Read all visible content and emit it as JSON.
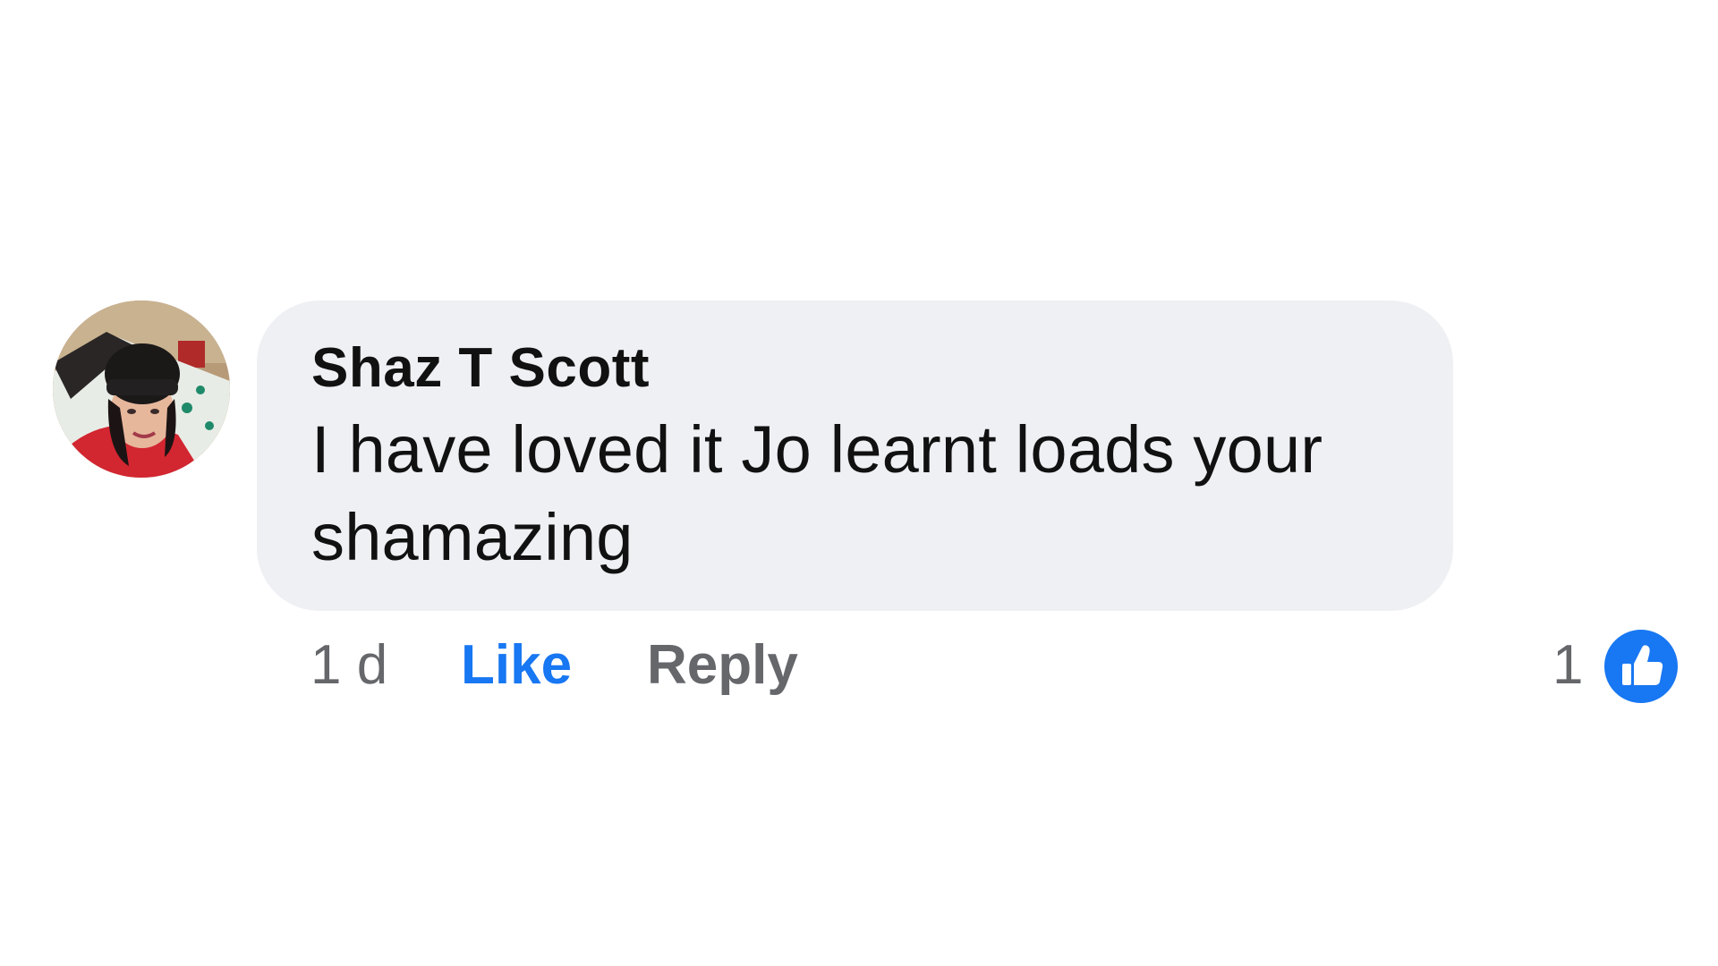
{
  "comment": {
    "author": "Shaz T Scott",
    "text_lines": [
      "I have loved it Jo learnt loads your",
      "shamazing"
    ],
    "timestamp": "1 d",
    "actions": {
      "like_label": "Like",
      "reply_label": "Reply"
    },
    "reactions": {
      "count": "1",
      "icon": "thumbs-up-icon"
    },
    "avatar_icon": "profile-photo"
  },
  "colors": {
    "bubble_background": "#eff0f4",
    "like_active": "#1877f2",
    "secondary_text": "#65676b",
    "primary_text": "#111111"
  }
}
